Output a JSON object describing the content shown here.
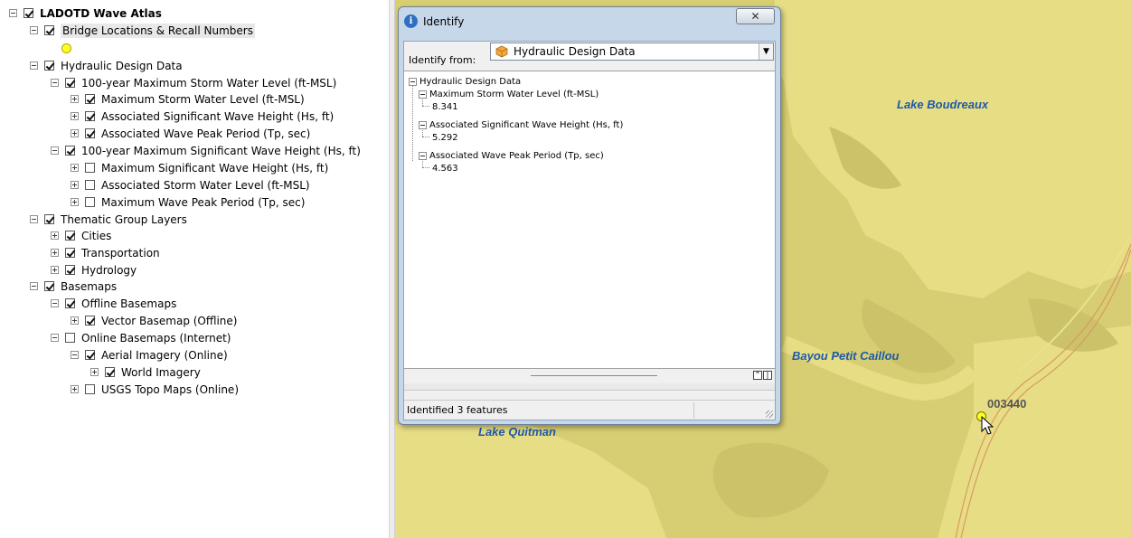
{
  "toc": {
    "items": [
      {
        "label": "LADOTD Wave Atlas",
        "checked": true,
        "expander": "minus"
      },
      {
        "label": "Bridge Locations & Recall Numbers",
        "checked": true,
        "expander": "minus"
      },
      {
        "label": "Hydraulic Design Data",
        "checked": true,
        "expander": "minus"
      },
      {
        "label": "100-year Maximum Storm Water Level (ft-MSL)",
        "checked": true,
        "expander": "minus"
      },
      {
        "label": "Maximum Storm Water Level (ft-MSL)",
        "checked": true,
        "expander": "plus"
      },
      {
        "label": "Associated  Significant Wave Height (Hs, ft)",
        "checked": true,
        "expander": "plus"
      },
      {
        "label": "Associated Wave Peak Period (Tp, sec)",
        "checked": true,
        "expander": "plus"
      },
      {
        "label": "100-year Maximum Significant Wave Height (Hs, ft)",
        "checked": true,
        "expander": "minus"
      },
      {
        "label": "Maximum Significant Wave Height (Hs, ft)",
        "checked": false,
        "expander": "plus"
      },
      {
        "label": "Associated Storm Water Level (ft-MSL)",
        "checked": false,
        "expander": "plus"
      },
      {
        "label": "Maximum Wave Peak Period (Tp, sec)",
        "checked": false,
        "expander": "plus"
      },
      {
        "label": "Thematic Group Layers",
        "checked": true,
        "expander": "minus"
      },
      {
        "label": "Cities",
        "checked": true,
        "expander": "plus"
      },
      {
        "label": "Transportation",
        "checked": true,
        "expander": "plus"
      },
      {
        "label": "Hydrology",
        "checked": true,
        "expander": "plus"
      },
      {
        "label": "Basemaps",
        "checked": true,
        "expander": "minus"
      },
      {
        "label": "Offline Basemaps",
        "checked": true,
        "expander": "minus"
      },
      {
        "label": "Vector Basemap (Offline)",
        "checked": true,
        "expander": "plus"
      },
      {
        "label": "Online Basemaps (Internet)",
        "checked": false,
        "expander": "minus"
      },
      {
        "label": "Aerial Imagery (Online)",
        "checked": true,
        "expander": "minus"
      },
      {
        "label": "World Imagery",
        "checked": true,
        "expander": "plus"
      },
      {
        "label": "USGS Topo Maps (Online)",
        "checked": false,
        "expander": "plus"
      }
    ]
  },
  "map": {
    "labels": {
      "lake_boudreaux": "Lake Boudreaux",
      "bayou_petit_caillou": "Bayou Petit Caillou",
      "lake_quitman": "Lake Quitman"
    },
    "bridge_number": "003440",
    "colors": {
      "land": "#e2d97a",
      "water": "#e2d97a",
      "marsh": "#cdc46a",
      "label": "#1f5aa8",
      "point": "#ffff22"
    }
  },
  "identify": {
    "title": "Identify",
    "close_glyph": "✕",
    "from_label": "Identify from:",
    "from_value": "Hydraulic Design Data",
    "tree": {
      "root": "Hydraulic Design Data",
      "fields": [
        {
          "name": "Maximum Storm Water Level (ft-MSL)",
          "value": "8.341"
        },
        {
          "name": "Associated  Significant Wave Height (Hs, ft)",
          "value": "5.292"
        },
        {
          "name": "Associated Wave Peak Period (Tp, sec)",
          "value": "4.563"
        }
      ]
    },
    "status": "Identified 3 features"
  }
}
